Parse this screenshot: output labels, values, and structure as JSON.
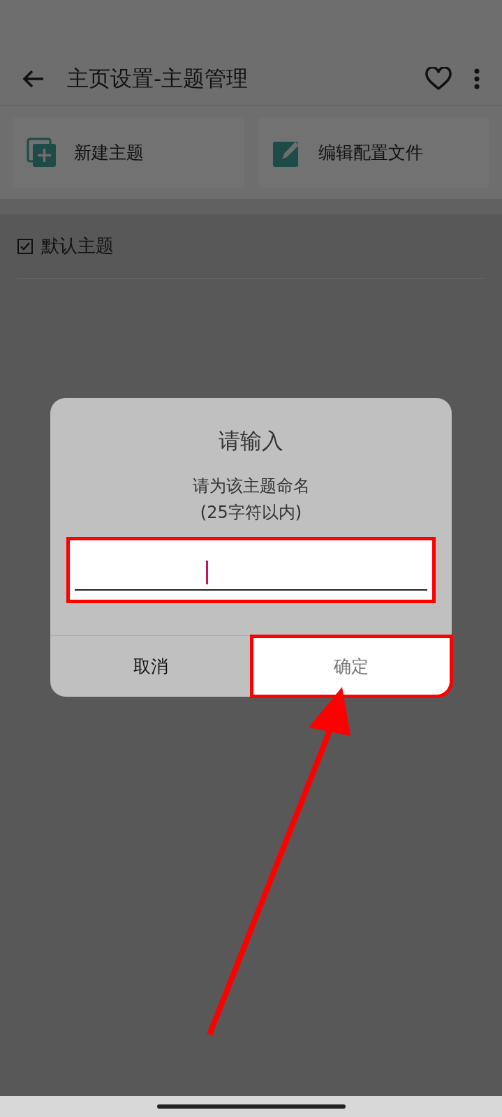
{
  "toolbar": {
    "title": "主页设置-主题管理"
  },
  "actions": [
    {
      "kind": "new",
      "label": "新建主题"
    },
    {
      "kind": "edit",
      "label": "编辑配置文件"
    }
  ],
  "themes": [
    {
      "label": "默认主题",
      "checked": true
    }
  ],
  "dialog": {
    "title": "请输入",
    "message": "请为该主题命名\n(25字符以内)",
    "buttons": [
      {
        "label": "取消",
        "highlighted": false
      },
      {
        "label": "确定",
        "highlighted": true
      }
    ]
  },
  "annotations": {
    "input_box": true,
    "arrow": true
  }
}
